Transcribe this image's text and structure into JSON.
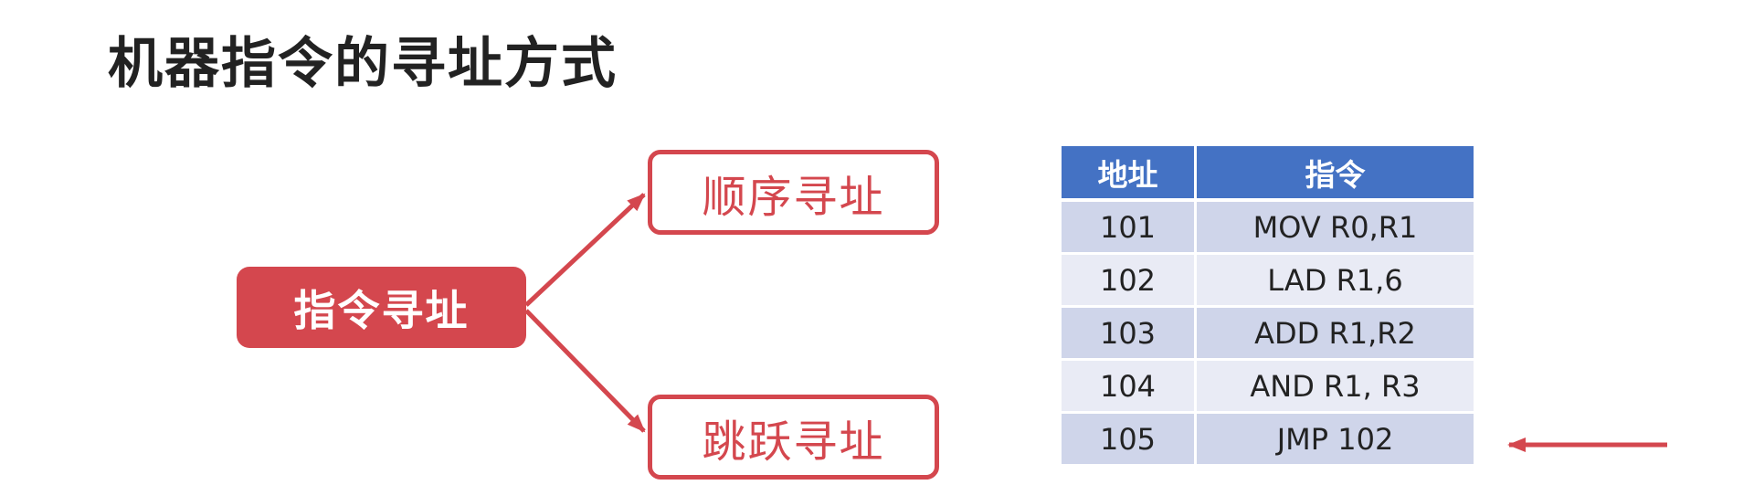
{
  "title": "机器指令的寻址方式",
  "diagram": {
    "main_node": "指令寻址",
    "branches": {
      "sequential": "顺序寻址",
      "jump": "跳跃寻址"
    }
  },
  "table": {
    "headers": [
      "地址",
      "指令"
    ],
    "rows": [
      [
        "101",
        "MOV R0,R1"
      ],
      [
        "102",
        "LAD R1,6"
      ],
      [
        "103",
        "ADD R1,R2"
      ],
      [
        "104",
        "AND R1, R3"
      ],
      [
        "105",
        "JMP 102"
      ]
    ],
    "pointer_row": "105"
  },
  "colors": {
    "accent_red": "#d4474e",
    "header_blue": "#4472c4",
    "row_dark": "#cfd5ea",
    "row_light": "#e9ebf5",
    "title": "#222222"
  }
}
